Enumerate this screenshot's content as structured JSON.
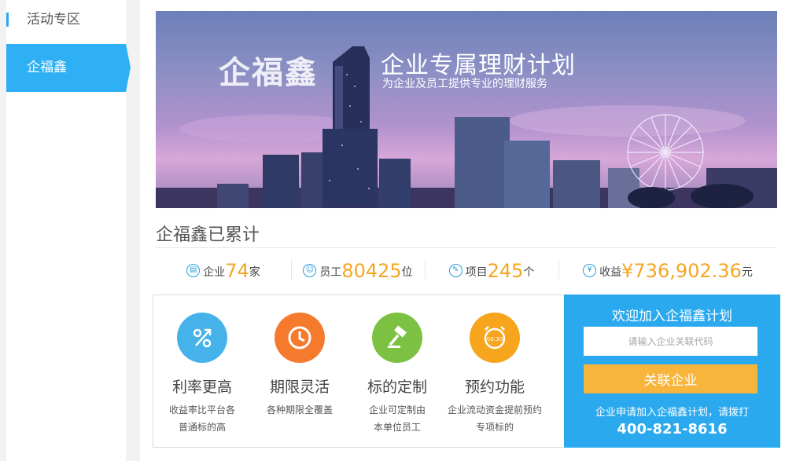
{
  "sidebar": {
    "items": [
      {
        "label": "活动专区",
        "active": false
      },
      {
        "label": "企福鑫",
        "active": true
      }
    ]
  },
  "banner": {
    "logo": "企福鑫",
    "title": "企业专属理财计划",
    "subtitle": "为企业及员工提供专业的理财服务"
  },
  "summary": {
    "title": "企福鑫已累计",
    "stats": [
      {
        "icon": "building-icon",
        "label": "企业",
        "value": "74",
        "unit": "家"
      },
      {
        "icon": "person-icon",
        "label": "员工",
        "value": "80425",
        "unit": "位"
      },
      {
        "icon": "document-icon",
        "label": "项目",
        "value": "245",
        "unit": "个"
      },
      {
        "icon": "yen-icon",
        "label": "收益",
        "value": "¥736,902.36",
        "unit": "元"
      }
    ]
  },
  "features": [
    {
      "icon": "percent-icon",
      "name": "利率更高",
      "desc_line1": "收益率比平台各",
      "desc_line2": "普通标的高",
      "color": "#45b3ea"
    },
    {
      "icon": "clock-icon",
      "name": "期限灵活",
      "desc_line1": "各种期限全覆盖",
      "desc_line2": "",
      "color": "#f57a2d"
    },
    {
      "icon": "hammer-icon",
      "name": "标的定制",
      "desc_line1": "企业可定制由",
      "desc_line2": "本单位员工",
      "color": "#7cc142"
    },
    {
      "icon": "alarm-icon",
      "name": "预约功能",
      "desc_line1": "企业流动资金提前预约",
      "desc_line2": "专项标的",
      "color": "#f6a51d"
    }
  ],
  "join": {
    "title": "欢迎加入企福鑫计划",
    "input_placeholder": "请输入企业关联代码",
    "button_label": "关联企业",
    "note": "企业申请加入企福鑫计划，请拨打",
    "phone": "400-821-8616"
  }
}
